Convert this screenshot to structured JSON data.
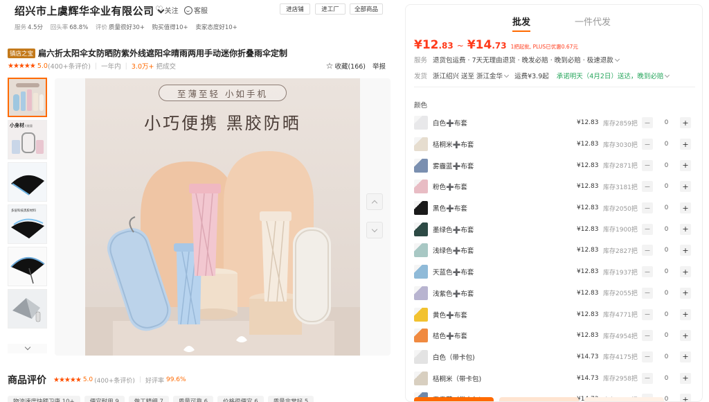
{
  "store": {
    "name": "绍兴市上虞辉华伞业有限公司",
    "follow": "关注",
    "service": "客服",
    "btn_store": "进店铺",
    "btn_factory": "进工厂",
    "btn_all": "全部商品",
    "metrics": [
      {
        "label": "服务",
        "value": "4.5分"
      },
      {
        "label": "回头率",
        "value": "68.8%"
      },
      {
        "label": "评价",
        "value": "质量很好30+"
      },
      {
        "label": "",
        "value": "购买值得10+"
      },
      {
        "label": "",
        "value": "卖家态度好10+"
      }
    ]
  },
  "product": {
    "badge": "镇店之宝",
    "title": "扁六折太阳伞女防晒防紫外线遮阳伞晴雨两用手动迷你折叠雨伞定制",
    "stars": "★★★★★",
    "score": "5.0",
    "review_count": "(400+条评价)",
    "period": "一年内",
    "sold_num": "3.0万+",
    "sold_label": "把成交",
    "favorite": "收藏(166)",
    "report": "举报"
  },
  "image": {
    "slogan1": "至薄至轻 小如手机",
    "slogan2": "小巧便携 黑胶防晒"
  },
  "reviews": {
    "title": "商品评价",
    "stars": "★★★★★",
    "score": "5.0",
    "count": "(400+条评价)",
    "good_rate_label": "好评率",
    "good_rate": "99.6%",
    "tags": [
      "物流速度快额卫康 10+",
      "便宜耐用 9",
      "做工精细 7",
      "质量可靠 6",
      "价格很便宜 6",
      "质量非常好 5"
    ]
  },
  "panel": {
    "tab_wholesale": "批发",
    "tab_dropship": "一件代发",
    "price_low_int": "¥12",
    "price_low_frac": ".83",
    "price_high_int": "¥14",
    "price_high_frac": ".73",
    "price_note": "1把起批, PLUS已优惠0.67元",
    "service_label": "服务",
    "service_text": "退货包运费 · 7天无理由退货 · 晚发必赔 · 晚到必赔 · 极速退款",
    "ship_label": "发货",
    "ship_from": "浙江绍兴 送至 浙江金华",
    "ship_fee": "运费¥3.9起",
    "ship_promise": "承诺明天（4月2日）送达，晚到必赔",
    "color_label": "颜色",
    "skus": [
      {
        "name": "白色➕布套",
        "price": "¥12.83",
        "stock": "库存2859把",
        "qty": "0",
        "color": "#e8e8ea"
      },
      {
        "name": "栝桐米➕布套",
        "price": "¥12.83",
        "stock": "库存3030把",
        "qty": "0",
        "color": "#e6ddcf"
      },
      {
        "name": "雾霾蓝➕布套",
        "price": "¥12.83",
        "stock": "库存2871把",
        "qty": "0",
        "color": "#7a8fb0"
      },
      {
        "name": "粉色➕布套",
        "price": "¥12.83",
        "stock": "库存3181把",
        "qty": "0",
        "color": "#e8bcc4"
      },
      {
        "name": "黑色➕布套",
        "price": "¥12.83",
        "stock": "库存2050把",
        "qty": "0",
        "color": "#1a1a1a"
      },
      {
        "name": "墨绿色➕布套",
        "price": "¥12.83",
        "stock": "库存1900把",
        "qty": "0",
        "color": "#2d4a45"
      },
      {
        "name": "浅绿色➕布套",
        "price": "¥12.83",
        "stock": "库存2827把",
        "qty": "0",
        "color": "#a8c8c4"
      },
      {
        "name": "天蓝色➕布套",
        "price": "¥12.83",
        "stock": "库存1937把",
        "qty": "0",
        "color": "#8fbad8"
      },
      {
        "name": "浅紫色➕布套",
        "price": "¥12.83",
        "stock": "库存2055把",
        "qty": "0",
        "color": "#b8b4d0"
      },
      {
        "name": "黄色➕布套",
        "price": "¥12.83",
        "stock": "库存4771把",
        "qty": "0",
        "color": "#f2c230"
      },
      {
        "name": "桔色➕布套",
        "price": "¥12.83",
        "stock": "库存4954把",
        "qty": "0",
        "color": "#f08a40"
      },
      {
        "name": "白色（带卡包)",
        "price": "¥14.73",
        "stock": "库存4175把",
        "qty": "0",
        "color": "#e3e3e3"
      },
      {
        "name": "栝桐米（带卡包)",
        "price": "¥14.73",
        "stock": "库存2958把",
        "qty": "0",
        "color": "#d8cfc0"
      },
      {
        "name": "雾霾蓝（带卡包)",
        "price": "¥14.73",
        "stock": "库存2360把",
        "qty": "0",
        "color": "#7088a8"
      }
    ]
  },
  "colors": {
    "accent": "#ff6a00",
    "price": "#ff3a1a",
    "green": "#25a55b"
  }
}
